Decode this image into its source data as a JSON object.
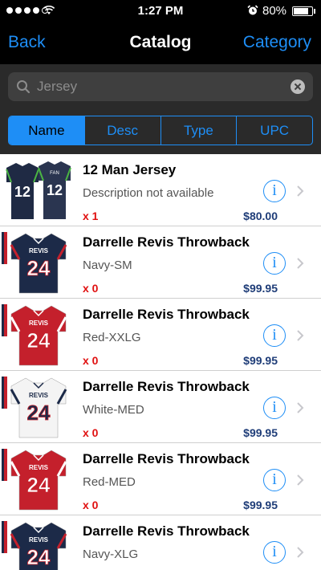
{
  "status_bar": {
    "time": "1:27 PM",
    "battery": "80%",
    "battery_level": 0.8,
    "signal_bars_filled": 4,
    "signal_bars_total": 5
  },
  "nav": {
    "back_label": "Back",
    "title": "Catalog",
    "category_label": "Category"
  },
  "search": {
    "value": "Jersey",
    "placeholder": "Search"
  },
  "segments": [
    {
      "label": "Name",
      "selected": true
    },
    {
      "label": "Desc",
      "selected": false
    },
    {
      "label": "Type",
      "selected": false
    },
    {
      "label": "UPC",
      "selected": false
    }
  ],
  "colors": {
    "accent": "#1e8ef6",
    "quantity": "#e01010",
    "price": "#1f3d78"
  },
  "products": [
    {
      "title": "12 Man Jersey",
      "description": "Description not available",
      "quantity": "x 1",
      "price": "$80.00",
      "jersey_color": "#1f2a44",
      "jersey_number": "12",
      "thumb_icon": "jersey-pair-icon"
    },
    {
      "title": "Darrelle Revis Throwback",
      "description": "Navy-SM",
      "quantity": "x 0",
      "price": "$99.95",
      "jersey_color": "#1c2a48",
      "jersey_number": "24",
      "name_on_jersey": "REVIS",
      "thumb_icon": "jersey-icon"
    },
    {
      "title": "Darrelle Revis Throwback",
      "description": "Red-XXLG",
      "quantity": "x 0",
      "price": "$99.95",
      "jersey_color": "#c4202c",
      "jersey_number": "24",
      "name_on_jersey": "REVIS",
      "thumb_icon": "jersey-icon"
    },
    {
      "title": "Darrelle Revis Throwback",
      "description": "White-MED",
      "quantity": "x 0",
      "price": "$99.95",
      "jersey_color": "#f4f4f4",
      "jersey_number": "24",
      "name_on_jersey": "REVIS",
      "thumb_icon": "jersey-icon"
    },
    {
      "title": "Darrelle Revis Throwback",
      "description": "Red-MED",
      "quantity": "x 0",
      "price": "$99.95",
      "jersey_color": "#c4202c",
      "jersey_number": "24",
      "name_on_jersey": "REVIS",
      "thumb_icon": "jersey-icon"
    },
    {
      "title": "Darrelle Revis Throwback",
      "description": "Navy-XLG",
      "quantity": "x 0",
      "price": "$99.95",
      "jersey_color": "#1c2a48",
      "jersey_number": "24",
      "name_on_jersey": "REVIS",
      "thumb_icon": "jersey-icon"
    }
  ]
}
